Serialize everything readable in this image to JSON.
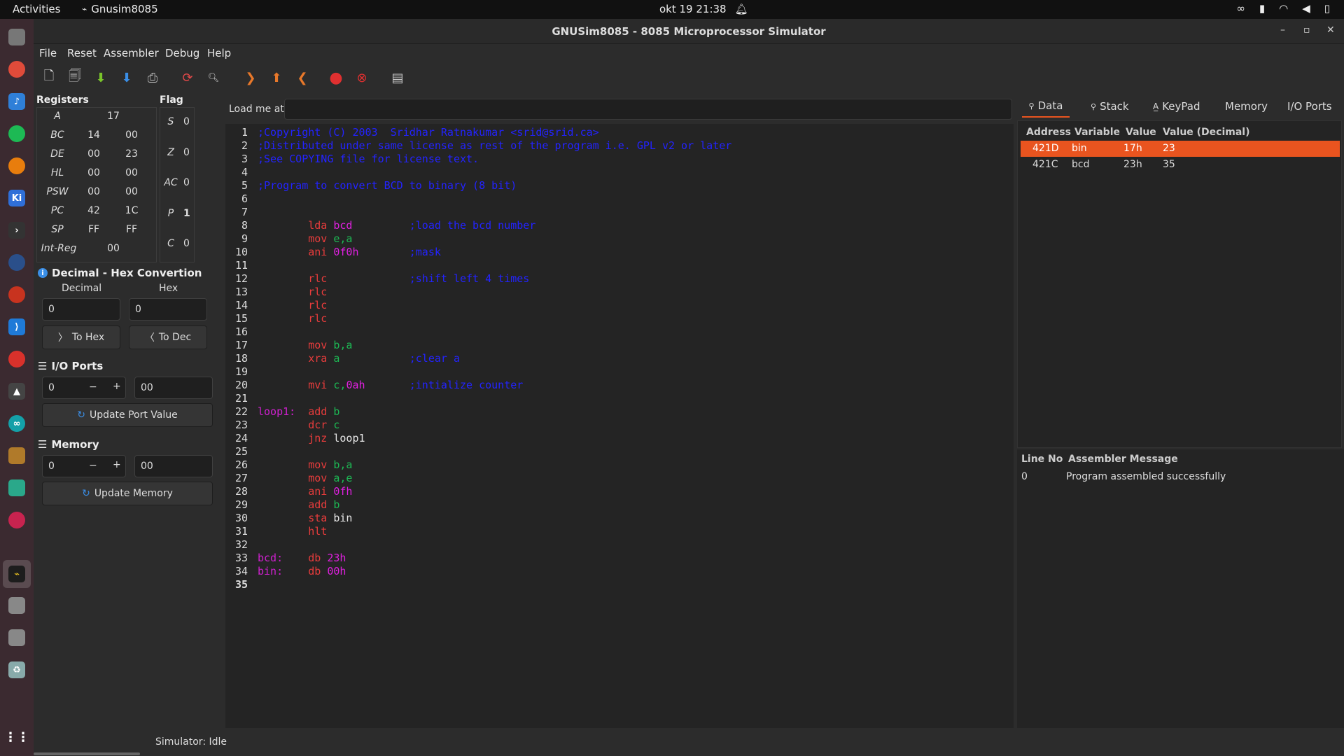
{
  "topbar": {
    "activities": "Activities",
    "app_name": "Gnusim8085",
    "datetime": "okt 19  21:38"
  },
  "window": {
    "title": "GNUSim8085 - 8085 Microprocessor Simulator"
  },
  "menu": [
    "File",
    "Reset",
    "Assembler",
    "Debug",
    "Help"
  ],
  "registers": {
    "title": "Registers",
    "rows": [
      {
        "name": "A",
        "v1": "17",
        "v2": ""
      },
      {
        "name": "BC",
        "v1": "14",
        "v2": "00"
      },
      {
        "name": "DE",
        "v1": "00",
        "v2": "23"
      },
      {
        "name": "HL",
        "v1": "00",
        "v2": "00"
      },
      {
        "name": "PSW",
        "v1": "00",
        "v2": "00"
      },
      {
        "name": "PC",
        "v1": "42",
        "v2": "1C"
      },
      {
        "name": "SP",
        "v1": "FF",
        "v2": "FF"
      },
      {
        "name": "Int-Reg",
        "v1": "00",
        "v2": ""
      }
    ]
  },
  "flags": {
    "title": "Flag",
    "rows": [
      {
        "name": "S",
        "value": "0"
      },
      {
        "name": "Z",
        "value": "0"
      },
      {
        "name": "AC",
        "value": "0"
      },
      {
        "name": "P",
        "value": "1"
      },
      {
        "name": "C",
        "value": "0"
      }
    ]
  },
  "convert": {
    "title": "Decimal - Hex Convertion",
    "decimal_label": "Decimal",
    "hex_label": "Hex",
    "decimal_value": "0",
    "hex_value": "0",
    "to_hex": "To Hex",
    "to_dec": "To Dec"
  },
  "ioports": {
    "title": "I/O Ports",
    "port": "0",
    "value": "00",
    "minus": "−",
    "plus": "+",
    "update": "Update Port Value"
  },
  "memory": {
    "title": "Memory",
    "address": "0",
    "value": "00",
    "minus": "−",
    "plus": "+",
    "update": "Update Memory"
  },
  "editor": {
    "load_label": "Load me at",
    "load_value": "",
    "lines": [
      [
        {
          "t": ";Copyright (C) 2003  Sridhar Ratnakumar <srid@srid.ca>",
          "c": "cm"
        }
      ],
      [
        {
          "t": ";Distributed under same license as rest of the program i.e. GPL v2 or later",
          "c": "cm"
        }
      ],
      [
        {
          "t": ";See COPYING file for license text.",
          "c": "cm"
        }
      ],
      [],
      [
        {
          "t": ";Program to convert BCD to binary (8 bit)",
          "c": "cm"
        }
      ],
      [],
      [],
      [
        {
          "t": "        lda ",
          "c": "kw"
        },
        {
          "t": "bcd",
          "c": "num"
        },
        {
          "t": "         ;load the bcd number",
          "c": "cm"
        }
      ],
      [
        {
          "t": "        mov ",
          "c": "kw"
        },
        {
          "t": "e,a",
          "c": "reg"
        }
      ],
      [
        {
          "t": "        ani ",
          "c": "kw"
        },
        {
          "t": "0f0h",
          "c": "num"
        },
        {
          "t": "        ;mask",
          "c": "cm"
        }
      ],
      [],
      [
        {
          "t": "        rlc",
          "c": "kw"
        },
        {
          "t": "             ;shift left 4 times",
          "c": "cm"
        }
      ],
      [
        {
          "t": "        rlc",
          "c": "kw"
        }
      ],
      [
        {
          "t": "        rlc",
          "c": "kw"
        }
      ],
      [
        {
          "t": "        rlc",
          "c": "kw"
        }
      ],
      [],
      [
        {
          "t": "        mov ",
          "c": "kw"
        },
        {
          "t": "b,a",
          "c": "reg"
        }
      ],
      [
        {
          "t": "        xra ",
          "c": "kw"
        },
        {
          "t": "a",
          "c": "reg"
        },
        {
          "t": "           ;clear a",
          "c": "cm"
        }
      ],
      [],
      [
        {
          "t": "        mvi ",
          "c": "kw"
        },
        {
          "t": "c,",
          "c": "reg"
        },
        {
          "t": "0ah",
          "c": "num"
        },
        {
          "t": "       ;intialize counter",
          "c": "cm"
        }
      ],
      [],
      [
        {
          "t": "loop1:  ",
          "c": "lab"
        },
        {
          "t": "add ",
          "c": "kw"
        },
        {
          "t": "b",
          "c": "reg"
        }
      ],
      [
        {
          "t": "        dcr ",
          "c": "kw"
        },
        {
          "t": "c",
          "c": "reg"
        }
      ],
      [
        {
          "t": "        jnz ",
          "c": "kw"
        },
        {
          "t": "loop1",
          "c": "plain"
        }
      ],
      [],
      [
        {
          "t": "        mov ",
          "c": "kw"
        },
        {
          "t": "b,a",
          "c": "reg"
        }
      ],
      [
        {
          "t": "        mov ",
          "c": "kw"
        },
        {
          "t": "a,e",
          "c": "reg"
        }
      ],
      [
        {
          "t": "        ani ",
          "c": "kw"
        },
        {
          "t": "0fh",
          "c": "num"
        }
      ],
      [
        {
          "t": "        add ",
          "c": "kw"
        },
        {
          "t": "b",
          "c": "reg"
        }
      ],
      [
        {
          "t": "        sta ",
          "c": "kw"
        },
        {
          "t": "bin",
          "c": "plain"
        }
      ],
      [
        {
          "t": "        hlt",
          "c": "kw"
        }
      ],
      [],
      [
        {
          "t": "bcd:    ",
          "c": "lab"
        },
        {
          "t": "db ",
          "c": "kw"
        },
        {
          "t": "23h",
          "c": "num"
        }
      ],
      [
        {
          "t": "bin:    ",
          "c": "lab"
        },
        {
          "t": "db ",
          "c": "kw"
        },
        {
          "t": "00h",
          "c": "num"
        }
      ],
      []
    ]
  },
  "tabs": [
    "Data",
    "Stack",
    "KeyPad",
    "Memory",
    "I/O Ports"
  ],
  "data_table": {
    "headers": [
      "Address",
      "Variable",
      "Value",
      "Value (Decimal)"
    ],
    "rows": [
      {
        "address": "421D",
        "variable": "bin",
        "value": "17h",
        "decimal": "23"
      },
      {
        "address": "421C",
        "variable": "bcd",
        "value": "23h",
        "decimal": "35"
      }
    ]
  },
  "messages": {
    "headers": [
      "Line No",
      "Assembler Message"
    ],
    "rows": [
      {
        "line": "0",
        "message": "Program assembled successfully"
      }
    ]
  },
  "status": "Simulator: Idle",
  "colors": {
    "selection": "#e9541f",
    "comment": "#2323ff",
    "keyword": "#e83c3c",
    "register": "#1db954",
    "number": "#e020e0"
  }
}
